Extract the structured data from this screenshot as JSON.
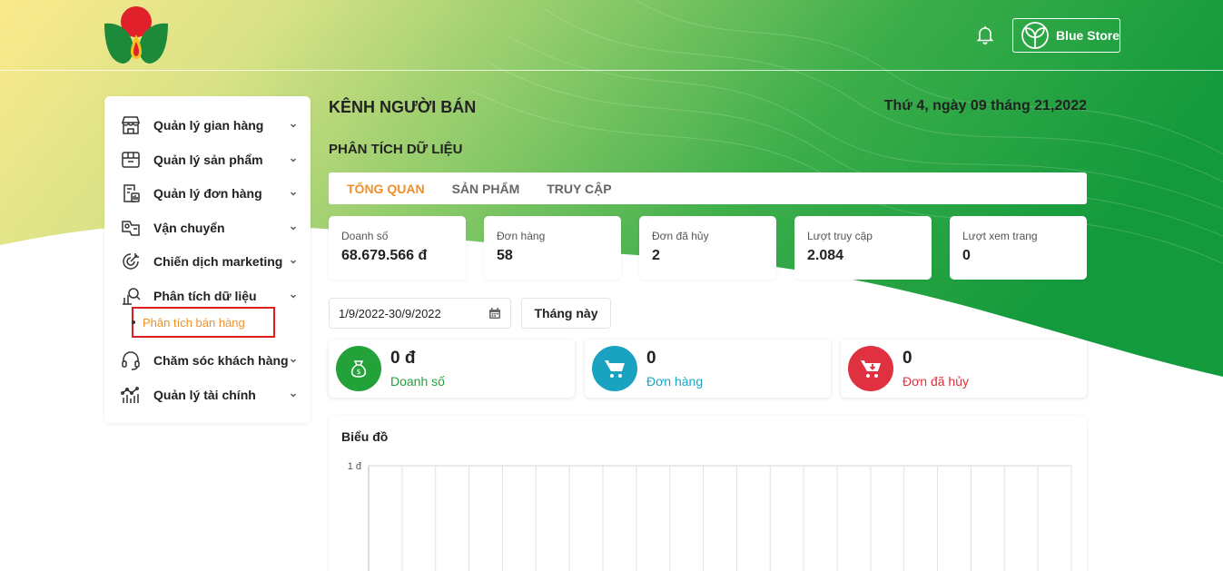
{
  "header": {
    "store_name": "Blue Store"
  },
  "sidebar": {
    "items": [
      {
        "label": "Quản lý gian hàng",
        "icon": "store-icon"
      },
      {
        "label": "Quản lý sản phẩm",
        "icon": "product-box-icon"
      },
      {
        "label": "Quản lý đơn hàng",
        "icon": "order-icon"
      },
      {
        "label": "Vận chuyển",
        "icon": "shipping-map-icon"
      },
      {
        "label": "Chiến dịch marketing",
        "icon": "marketing-target-icon"
      },
      {
        "label": "Phân tích dữ liệu",
        "icon": "data-analysis-icon"
      },
      {
        "label": "Chăm sóc khách hàng",
        "icon": "headset-icon"
      },
      {
        "label": "Quản lý tài chính",
        "icon": "finance-chart-icon"
      }
    ],
    "active_sub": "Phân tích bán hàng"
  },
  "main": {
    "title": "KÊNH NGƯỜI BÁN",
    "date": "Thứ 4, ngày 09 tháng 21,2022",
    "section": "PHÂN TÍCH DỮ LIỆU",
    "tabs": [
      "TỔNG QUAN",
      "SẢN PHẨM",
      "TRUY CẬP"
    ],
    "stats": [
      {
        "label": "Doanh số",
        "value": "68.679.566 đ"
      },
      {
        "label": "Đơn hàng",
        "value": "58"
      },
      {
        "label": "Đơn đã hủy",
        "value": "2"
      },
      {
        "label": "Lượt truy cập",
        "value": "2.084"
      },
      {
        "label": "Lượt xem trang",
        "value": "0"
      }
    ],
    "date_range": "1/9/2022-30/9/2022",
    "month_button": "Tháng này",
    "summary": [
      {
        "value": "0 đ",
        "label": "Doanh số",
        "color": "#22a238",
        "icon": "money-bag-icon"
      },
      {
        "value": "0",
        "label": "Đơn hàng",
        "color": "#1aa3c1",
        "icon": "cart-icon"
      },
      {
        "value": "0",
        "label": "Đơn đã hủy",
        "color": "#df3140",
        "icon": "cart-cancel-icon"
      }
    ],
    "chart_title": "Biểu đồ"
  },
  "colors": {
    "accent_orange": "#f0902a",
    "green": "#22a238",
    "teal": "#1aa3c1",
    "red": "#df3140"
  },
  "chart_data": {
    "type": "bar",
    "title": "Biểu đồ",
    "y_tick_labels": [
      "1 đ"
    ],
    "ylim": [
      0,
      1
    ],
    "grid": true,
    "vertical_gridlines": 21
  }
}
